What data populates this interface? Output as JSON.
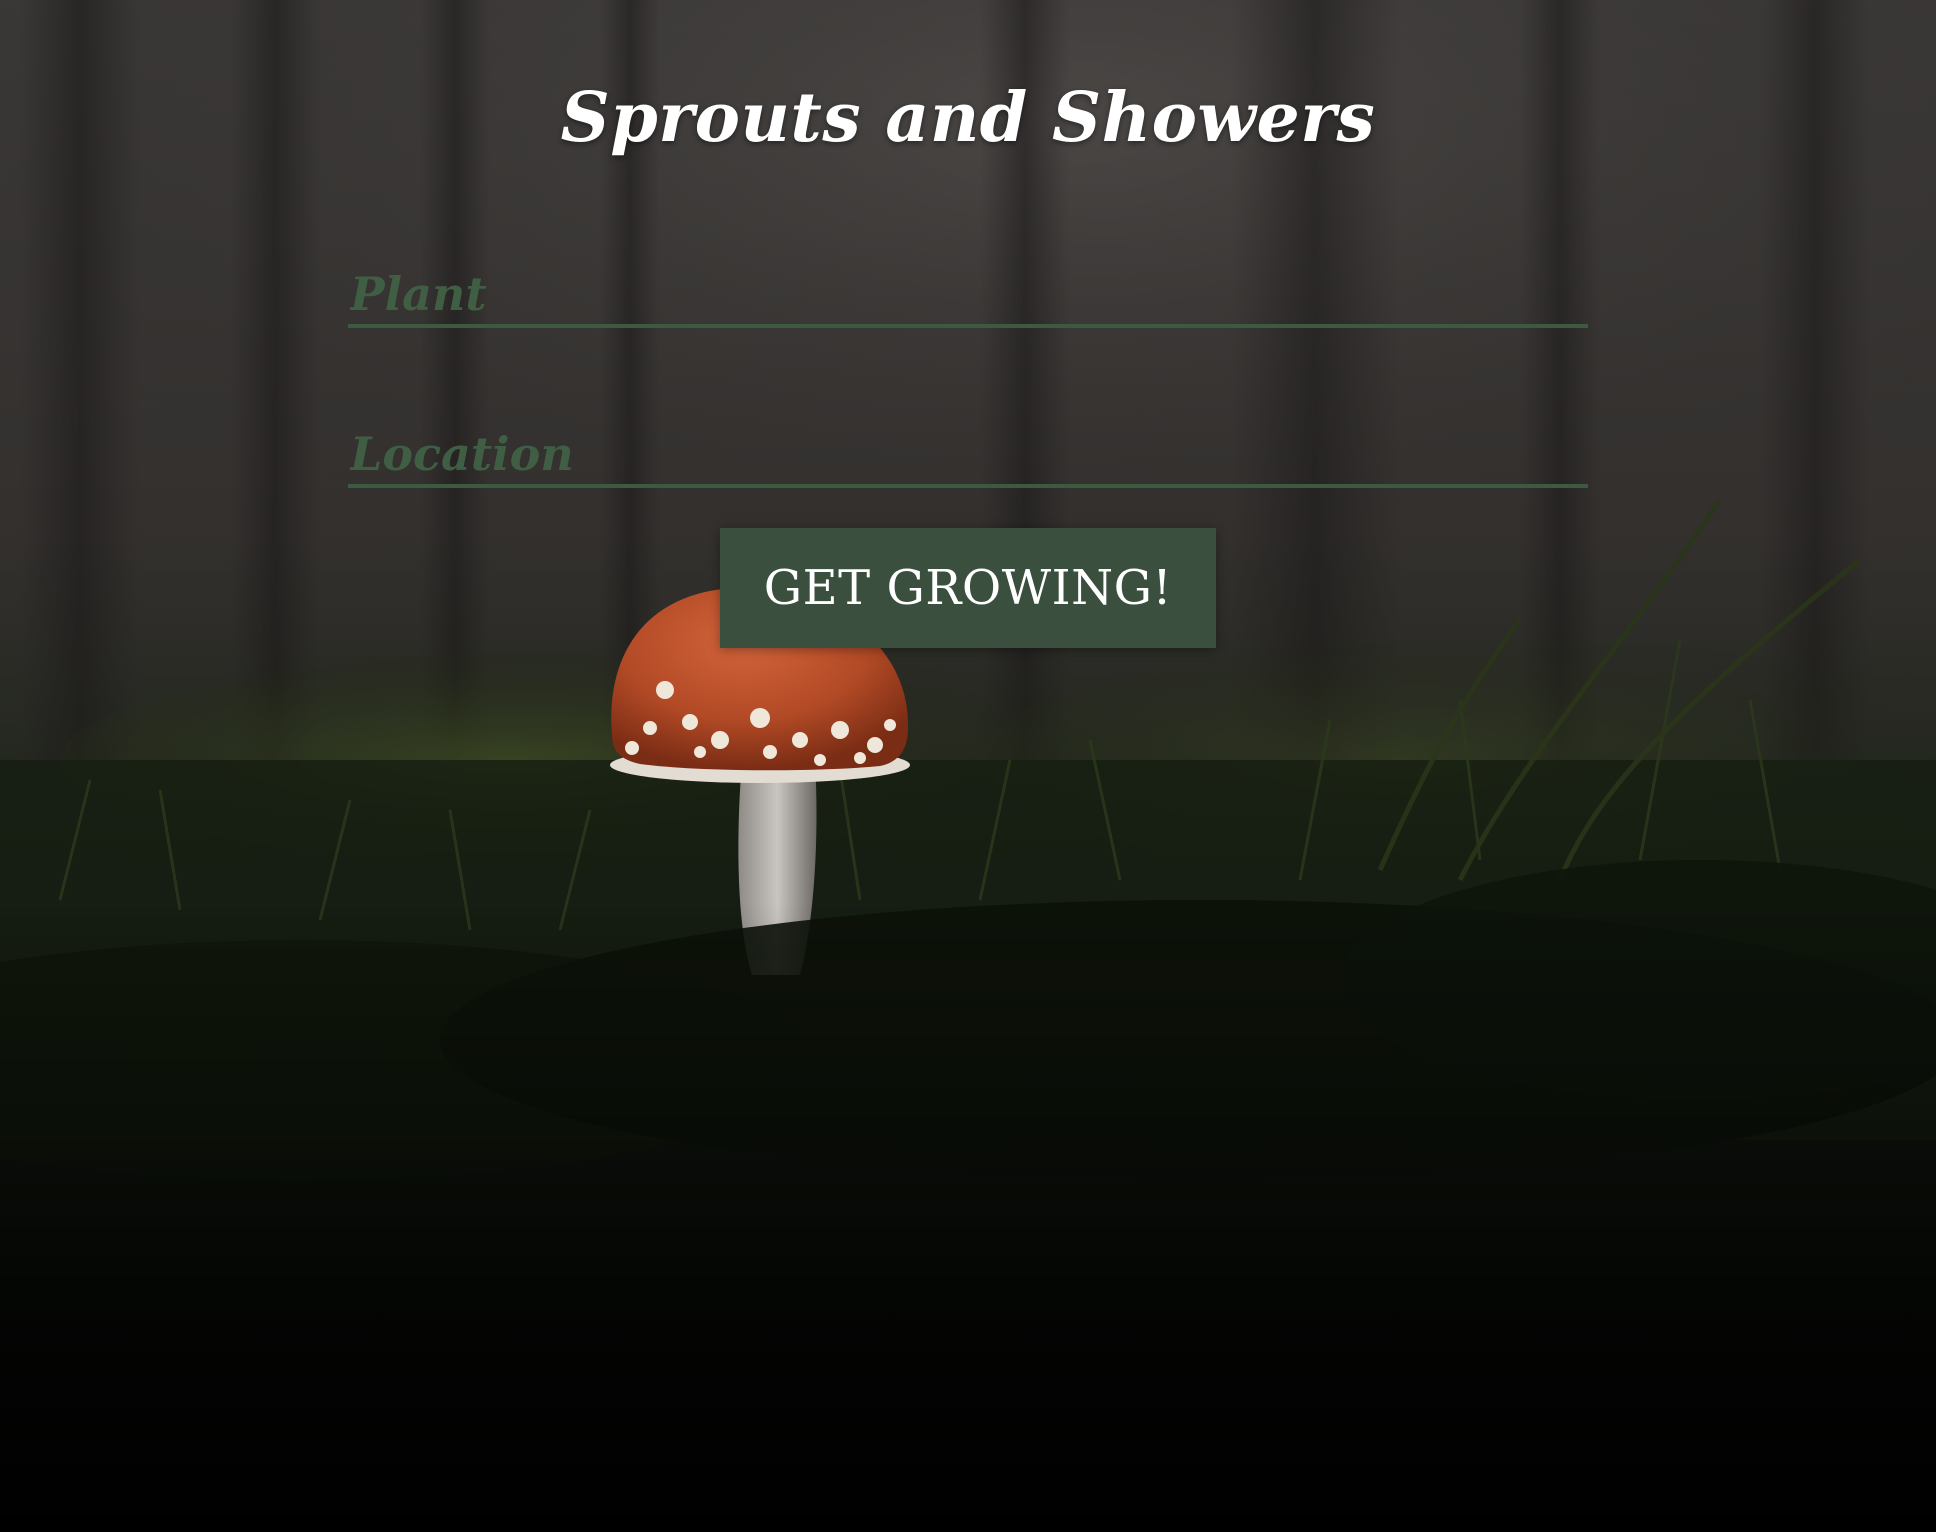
{
  "app": {
    "title": "Sprouts and Showers"
  },
  "form": {
    "plant": {
      "value": "",
      "placeholder": "Plant"
    },
    "location": {
      "value": "",
      "placeholder": "Location"
    },
    "submit_label": "GET GROWING!"
  },
  "colors": {
    "accent": "#3a4f3d",
    "input_underline": "#3c5a40",
    "placeholder": "#3f5e44",
    "title": "#ffffff"
  },
  "background": {
    "scene": "dark-forest-mushroom-photo"
  }
}
